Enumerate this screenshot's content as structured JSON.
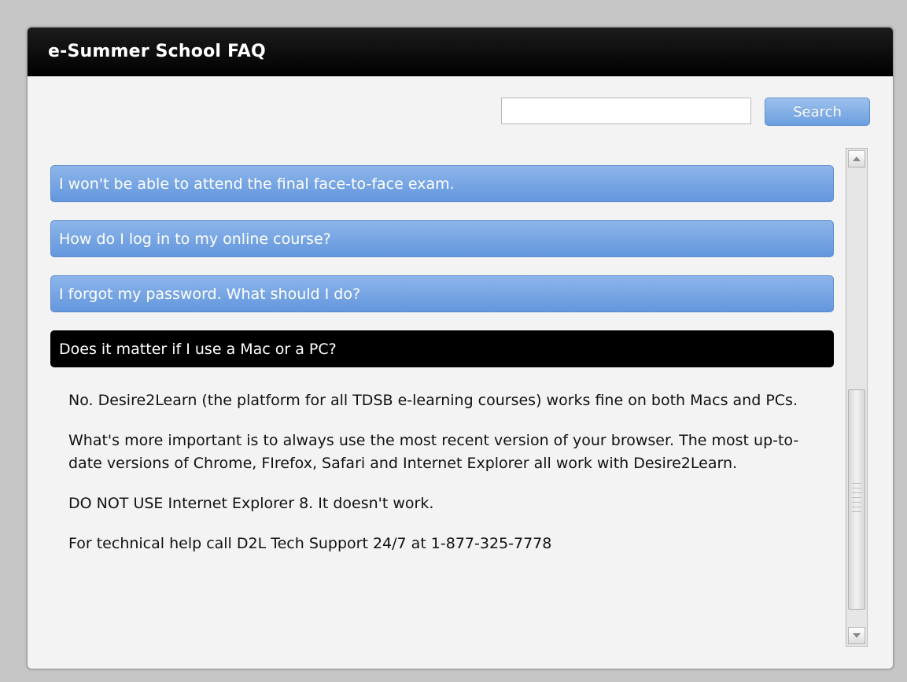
{
  "window": {
    "title": "e-Summer School FAQ"
  },
  "search": {
    "value": "",
    "placeholder": "",
    "button_label": "Search"
  },
  "faq": {
    "questions": [
      {
        "label": "I won't be able to attend the final face-to-face exam.",
        "state": "collapsed"
      },
      {
        "label": "How do I log in to my online course?",
        "state": "collapsed"
      },
      {
        "label": "I forgot my password. What should I do?",
        "state": "collapsed"
      },
      {
        "label": "Does it matter if I use a Mac or a PC?",
        "state": "expanded"
      }
    ],
    "answer": {
      "paragraphs": [
        "No. Desire2Learn (the platform for all TDSB e-learning courses) works fine on both Macs and PCs.",
        "What's more important is to always use the most recent version of your browser. The most up-to-date versions of Chrome, FIrefox, Safari and Internet Explorer all work with Desire2Learn.",
        "DO NOT USE Internet Explorer 8. It doesn't work.",
        "For technical help call D2L Tech Support 24/7 at 1-877-325-7778"
      ]
    }
  },
  "colors": {
    "collapsed_question_bg": "#6f9fe0",
    "expanded_question_bg": "#000000",
    "title_bar_bg": "#000000",
    "search_button_bg": "#7eaae5",
    "page_bg": "#c6c6c6",
    "panel_bg": "#f3f3f3"
  },
  "icons": {
    "scroll_up": "chevron-up-icon",
    "scroll_down": "chevron-down-icon"
  }
}
